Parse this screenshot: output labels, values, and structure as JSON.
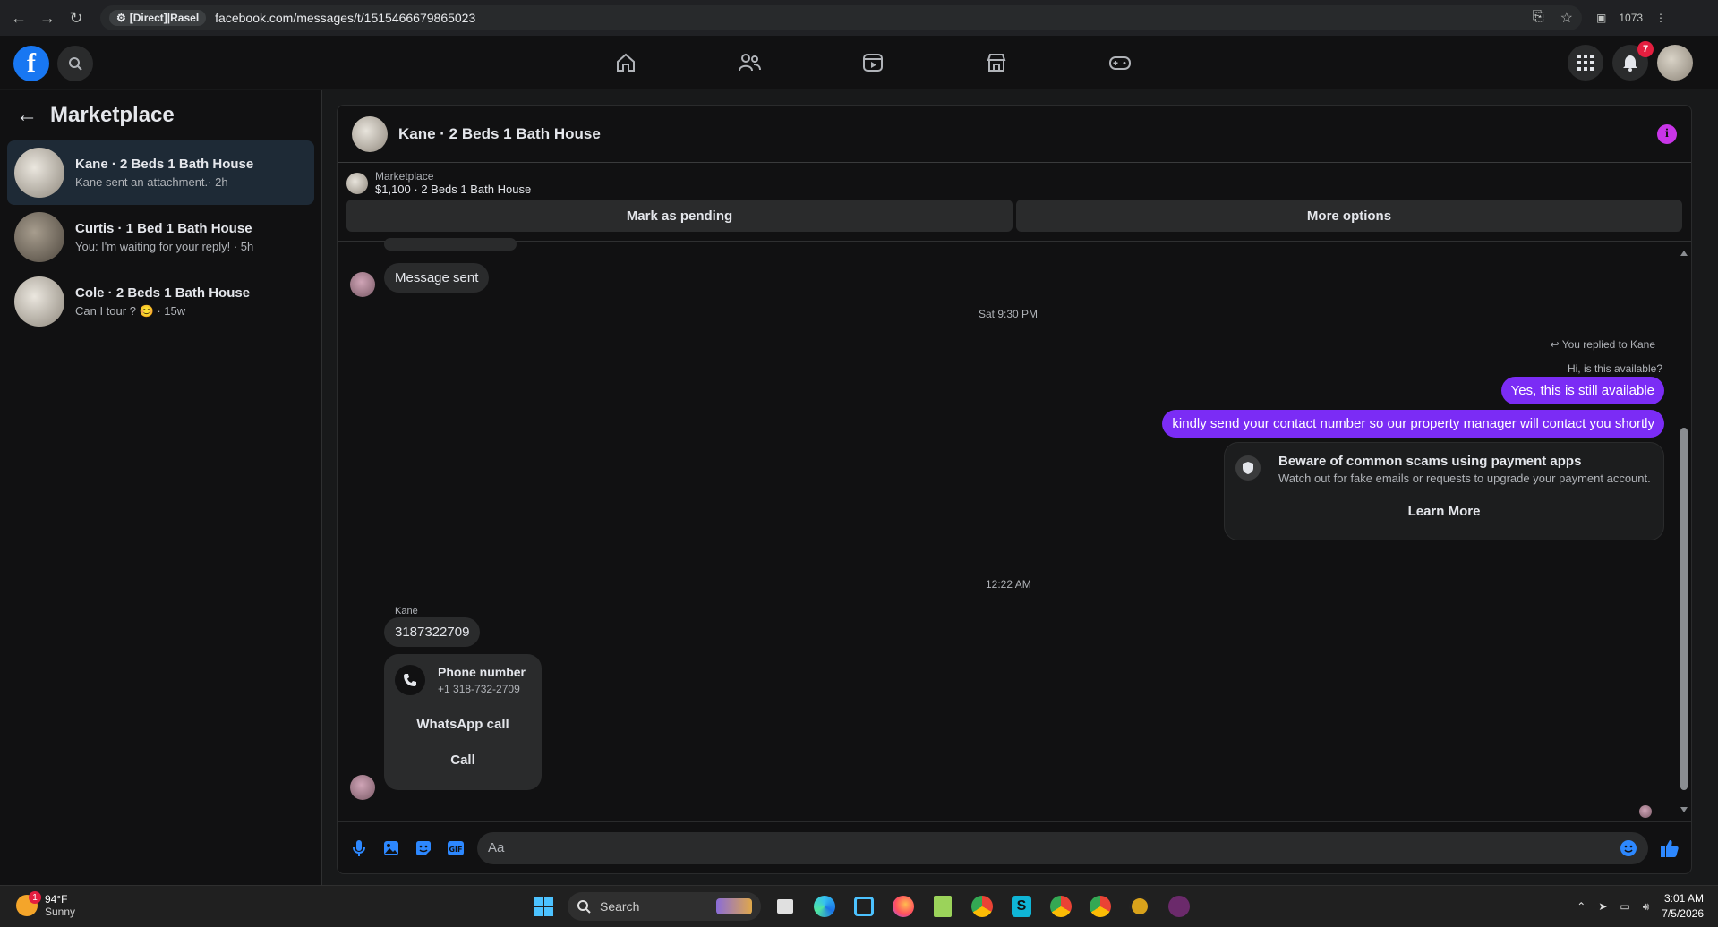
{
  "browser": {
    "site_badge": "[Direct]|Rasel",
    "url": "facebook.com/messages/t/1515466679865023",
    "extension_count": "1073"
  },
  "topbar": {
    "notifications_count": "7"
  },
  "sidebar": {
    "title": "Marketplace",
    "conversations": [
      {
        "title": "Kane · 2 Beds 1 Bath House",
        "subtitle": "Kane sent an attachment.· 2h",
        "active": true
      },
      {
        "title": "Curtis · 1 Bed 1 Bath House",
        "subtitle": "You: I'm waiting for your reply! · 5h",
        "active": false
      },
      {
        "title": "Cole · 2 Beds 1 Bath House",
        "subtitle": "Can I tour ? 😊 · 15w",
        "active": false
      }
    ]
  },
  "chat": {
    "title": "Kane · 2 Beds 1 Bath House",
    "listing_source": "Marketplace",
    "listing_title": "$1,100 · 2 Beds 1 Bath House",
    "mark_pending_label": "Mark as pending",
    "more_options_label": "More options",
    "messages": {
      "message_sent": "Message sent",
      "timestamp_1": "Sat 9:30 PM",
      "replied_to": "You replied to Kane",
      "quoted": "Hi, is this available?",
      "reply_1": "Yes, this is still available",
      "reply_2": "kindly send your contact number so our property manager will contact you shortly",
      "scam_title": "Beware of common scams using payment apps",
      "scam_body": "Watch out for fake emails or requests to upgrade your payment account.",
      "scam_link": "Learn More",
      "timestamp_2": "12:22 AM",
      "sender_name": "Kane",
      "phone_text": "3187322709",
      "phone_card_title": "Phone number",
      "phone_card_number": "+1 318-732-2709",
      "whatsapp_label": "WhatsApp call",
      "call_label": "Call"
    },
    "composer_placeholder": "Aa"
  },
  "taskbar": {
    "weather_temp": "94°F",
    "weather_desc": "Sunny",
    "weather_badge": "1",
    "search_label": "Search",
    "time": "3:01 AM",
    "date": "7/5/2026"
  }
}
